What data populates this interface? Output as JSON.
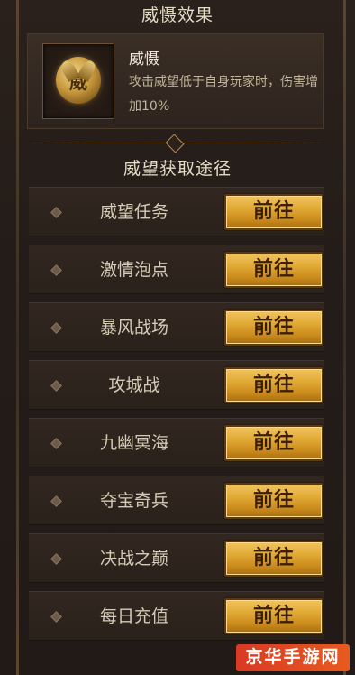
{
  "header": {
    "effect_title": "威慑效果",
    "routes_title": "威望获取途径"
  },
  "effect": {
    "badge_char": "威",
    "name": "威慑",
    "description": "攻击威望低于自身玩家时，伤害增加10%"
  },
  "routes": [
    {
      "label": "威望任务",
      "button": "前往"
    },
    {
      "label": "激情泡点",
      "button": "前往"
    },
    {
      "label": "暴风战场",
      "button": "前往"
    },
    {
      "label": "攻城战",
      "button": "前往"
    },
    {
      "label": "九幽冥海",
      "button": "前往"
    },
    {
      "label": "夺宝奇兵",
      "button": "前往"
    },
    {
      "label": "决战之巅",
      "button": "前往"
    },
    {
      "label": "每日充值",
      "button": "前往"
    }
  ],
  "watermark": {
    "text": "京华手游网"
  },
  "colors": {
    "button_gold": "#e0a834",
    "background": "#241c18",
    "watermark_red": "#d93a24"
  }
}
